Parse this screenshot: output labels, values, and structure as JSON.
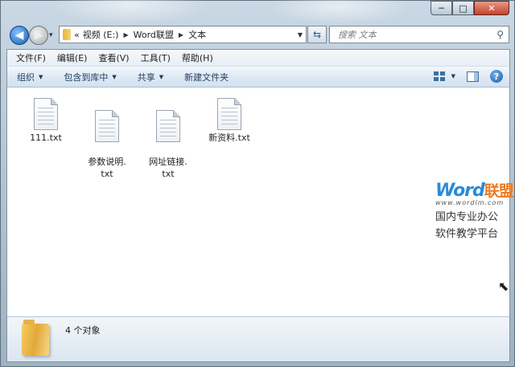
{
  "window": {
    "caption": {
      "minimize": "─",
      "maximize": "□",
      "close": "✕"
    }
  },
  "nav": {
    "back_icon": "back-arrow-icon",
    "forward_icon": "forward-arrow-icon",
    "history": "▾",
    "address": {
      "overflow": "«",
      "crumbs": [
        "视频 (E:)",
        "Word联盟",
        "文本"
      ]
    },
    "refresh_icon": "refresh-icon",
    "search_placeholder": "搜索 文本",
    "search_glyph": "⚲"
  },
  "menu": [
    "文件(F)",
    "编辑(E)",
    "查看(V)",
    "工具(T)",
    "帮助(H)"
  ],
  "toolbar": {
    "organize": "组织",
    "include_in_library": "包含到库中",
    "share": "共享",
    "new_folder": "新建文件夹",
    "help": "?"
  },
  "files": [
    {
      "name": "111.txt"
    },
    {
      "name": "参数说明.\ntxt"
    },
    {
      "name": "网址链接.\ntxt"
    },
    {
      "name": "新资料.txt"
    }
  ],
  "watermark": {
    "brand_en": "Word",
    "brand_cn": "联盟",
    "url": "www.wordlm.com",
    "line1": "国内专业办公",
    "line2": "软件教学平台"
  },
  "details": {
    "count": "4 个对象"
  }
}
